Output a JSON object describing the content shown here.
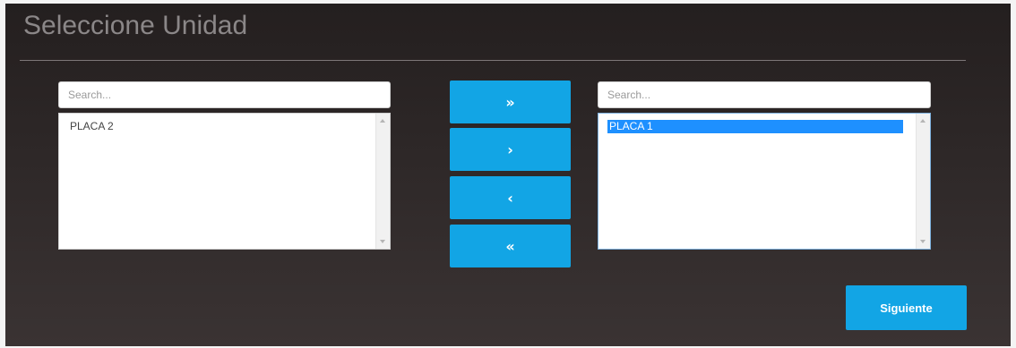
{
  "header": {
    "title": "Seleccione Unidad"
  },
  "available": {
    "search_placeholder": "Search...",
    "items": [
      "PLACA 2"
    ]
  },
  "selected": {
    "search_placeholder": "Search...",
    "items": [
      "PLACA 1"
    ]
  },
  "transfer_buttons": {
    "move_all_right": "»",
    "move_right": "›",
    "move_left": "‹",
    "move_all_left": "«"
  },
  "footer": {
    "next_label": "Siguiente"
  },
  "colors": {
    "accent": "#12a5e5",
    "selection": "#1e90ff",
    "panel_bg": "#2e2828"
  }
}
